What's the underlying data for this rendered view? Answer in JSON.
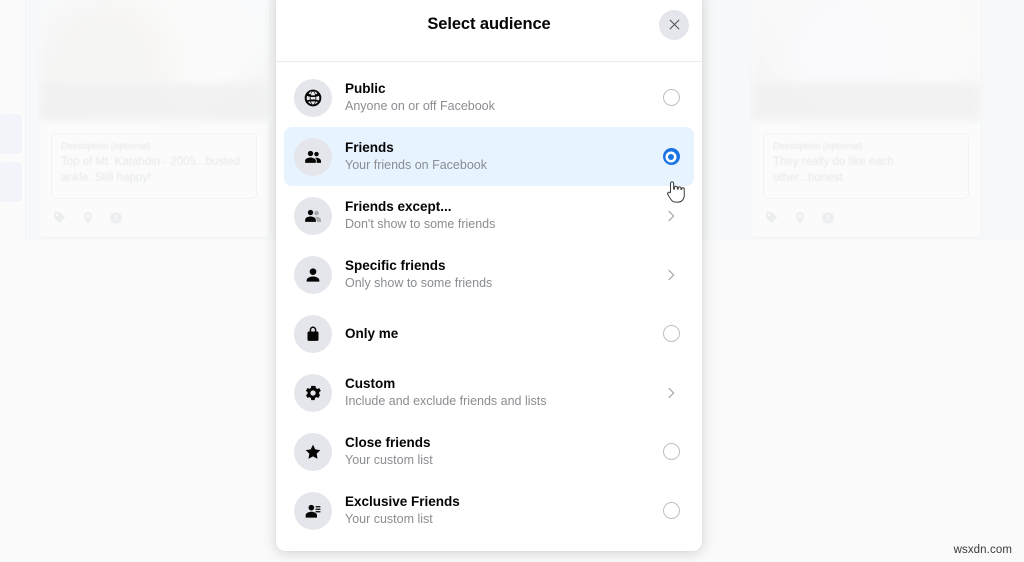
{
  "background": {
    "left_card": {
      "description_label": "Description (optional)",
      "description_text": "Top of Mt. Katahdin - 2005...busted ankle.  Still happy!",
      "icons": [
        "tag-icon",
        "location-pin-icon",
        "clock-icon"
      ]
    },
    "right_card": {
      "description_label": "Description (optional)",
      "description_text": "They really do like each other...honest.",
      "icons": [
        "tag-icon",
        "location-pin-icon",
        "clock-icon"
      ]
    }
  },
  "modal": {
    "title": "Select audience",
    "close_icon": "close-icon",
    "accent_color": "#1b74e4",
    "selected_background": "#e7f3ff",
    "options": [
      {
        "id": "public",
        "title": "Public",
        "subtitle": "Anyone on or off Facebook",
        "icon": "globe-icon",
        "control": "radio",
        "selected": false
      },
      {
        "id": "friends",
        "title": "Friends",
        "subtitle": "Your friends on Facebook",
        "icon": "friends-icon",
        "control": "radio",
        "selected": true
      },
      {
        "id": "friends-except",
        "title": "Friends except...",
        "subtitle": "Don't show to some friends",
        "icon": "friends-except-icon",
        "control": "chevron",
        "selected": false
      },
      {
        "id": "specific-friends",
        "title": "Specific friends",
        "subtitle": "Only show to some friends",
        "icon": "person-icon",
        "control": "chevron",
        "selected": false
      },
      {
        "id": "only-me",
        "title": "Only me",
        "subtitle": "",
        "icon": "lock-icon",
        "control": "radio",
        "selected": false
      },
      {
        "id": "custom",
        "title": "Custom",
        "subtitle": "Include and exclude friends and lists",
        "icon": "gear-icon",
        "control": "chevron",
        "selected": false
      },
      {
        "id": "close-friends",
        "title": "Close friends",
        "subtitle": "Your custom list",
        "icon": "star-icon",
        "control": "radio",
        "selected": false
      },
      {
        "id": "exclusive-friends",
        "title": "Exclusive Friends",
        "subtitle": "Your custom list",
        "icon": "person-list-icon",
        "control": "radio",
        "selected": false
      }
    ]
  },
  "watermark": "wsxdn.com"
}
